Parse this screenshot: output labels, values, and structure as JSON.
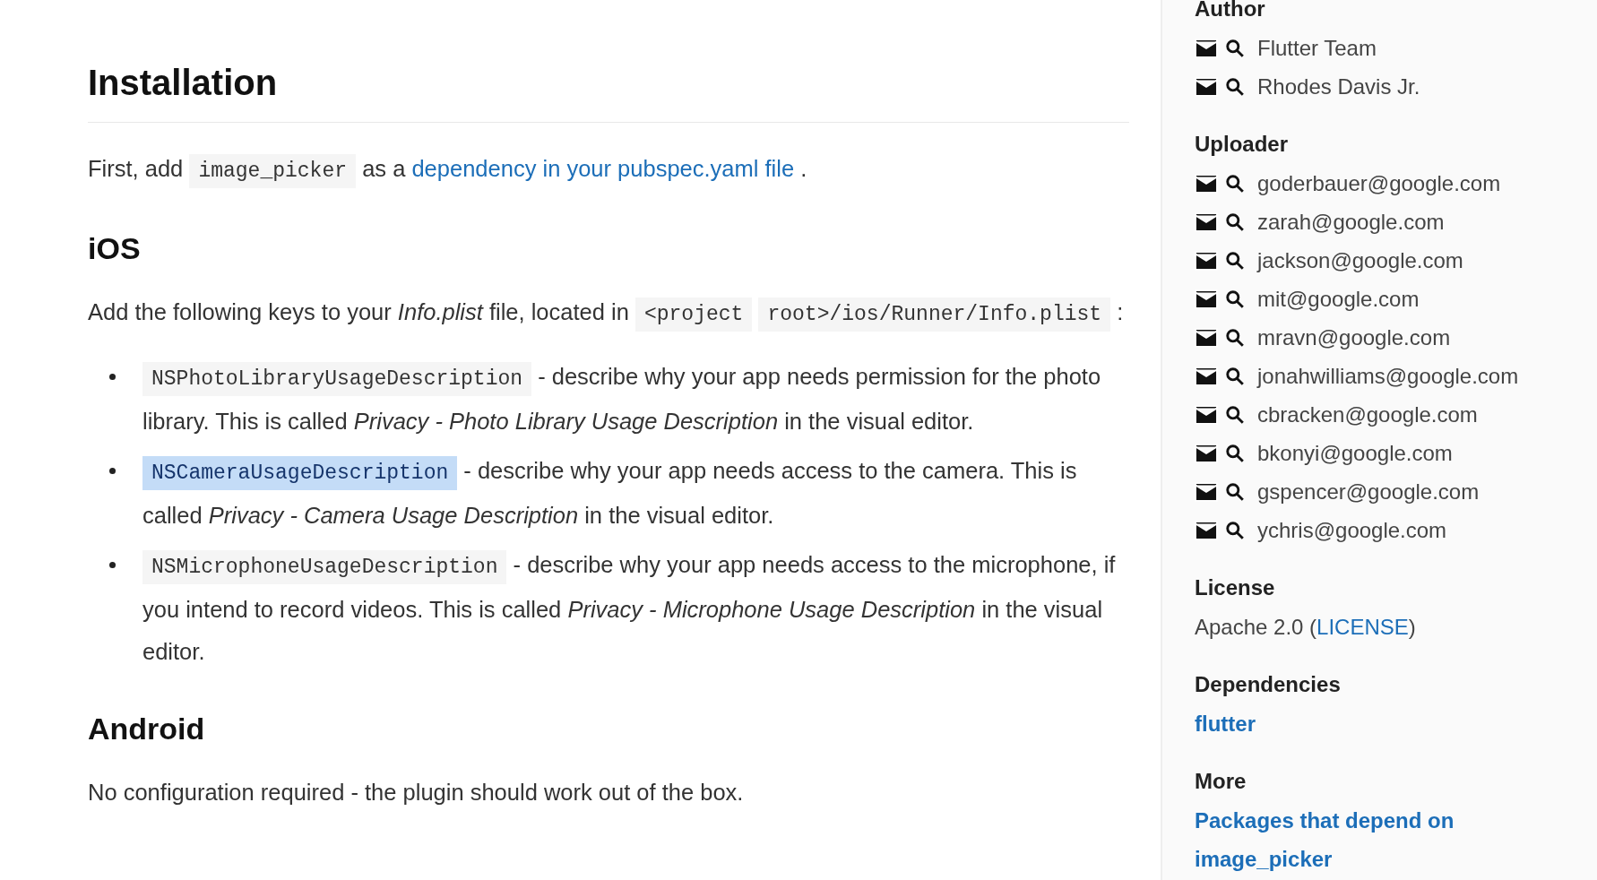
{
  "content": [
    {
      "kind": "h2",
      "text": "Installation"
    },
    {
      "kind": "p",
      "segments": [
        {
          "kind": "text",
          "text": "First, add"
        },
        {
          "kind": "code",
          "text": "image_picker"
        },
        {
          "kind": "text",
          "text": "as a"
        },
        {
          "kind": "link",
          "text": "dependency in your pubspec.yaml file"
        },
        {
          "kind": "text",
          "text": "."
        }
      ]
    },
    {
      "kind": "h3",
      "text": "iOS"
    },
    {
      "kind": "p",
      "segments": [
        {
          "kind": "text",
          "text": "Add the following keys to your *Info.plist* file, located in"
        },
        {
          "kind": "code",
          "text": "<project"
        },
        {
          "kind": "code",
          "text": "root>/ios/Runner/Info.plist"
        },
        {
          "kind": "text",
          "text": ":"
        }
      ]
    },
    {
      "kind": "ul",
      "items": [
        {
          "code": "NSPhotoLibraryUsageDescription",
          "highlighted": false,
          "text": "- describe why your app needs permission for the photo library. This is called *Privacy - Photo Library Usage Description* in the visual editor."
        },
        {
          "code": "NSCameraUsageDescription",
          "highlighted": true,
          "text": "- describe why your app needs access to the camera. This is called *Privacy - Camera Usage Description* in the visual editor."
        },
        {
          "code": "NSMicrophoneUsageDescription",
          "highlighted": false,
          "text": "- describe why your app needs access to the microphone, if you intend to record videos. This is called *Privacy - Microphone Usage Description* in the visual editor."
        }
      ]
    },
    {
      "kind": "h3",
      "text": "Android"
    },
    {
      "kind": "p",
      "segments": [
        {
          "kind": "text",
          "text": "No configuration required - the plugin should work out of the box."
        }
      ]
    }
  ],
  "sidebar": [
    {
      "heading": "Author",
      "kind": "people",
      "items": [
        "Flutter Team",
        "Rhodes Davis Jr."
      ]
    },
    {
      "heading": "Uploader",
      "kind": "people",
      "items": [
        "goderbauer@google.com",
        "zarah@google.com",
        "jackson@google.com",
        "mit@google.com",
        "mravn@google.com",
        "jonahwilliams@google.com",
        "cbracken@google.com",
        "bkonyi@google.com",
        "gspencer@google.com",
        "ychris@google.com"
      ]
    },
    {
      "heading": "License",
      "kind": "license",
      "text": "Apache 2.0 (",
      "link": "LICENSE",
      "after": ")"
    },
    {
      "heading": "Dependencies",
      "kind": "links",
      "items": [
        "flutter"
      ]
    },
    {
      "heading": "More",
      "kind": "links",
      "items": [
        "Packages that depend on image_picker"
      ]
    }
  ]
}
